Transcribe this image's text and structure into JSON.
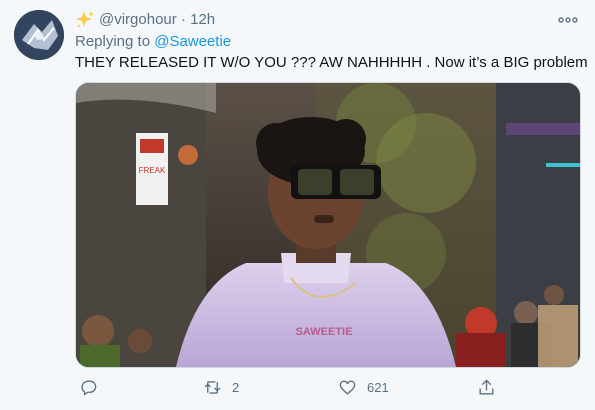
{
  "tweet": {
    "display_icon": "sparkles-icon",
    "handle": "@virgohour",
    "separator": "·",
    "time": "12h",
    "reply_prefix": "Replying to ",
    "reply_to": "@Saweetie",
    "text": "THEY RELEASED IT W/O YOU ??? AW NAHHHHH . Now it’s a BIG problem",
    "media": {
      "sign_text": "FREAK",
      "shirt_text": "SAWEETIE"
    },
    "actions": {
      "reply_count": "",
      "retweet_count": "2",
      "like_count": "621"
    }
  },
  "colors": {
    "background": "#f5f8fa",
    "text": "#0f1419",
    "secondary": "#5b7083",
    "link": "#1b95e0",
    "sparkle": "#ffcc4d"
  }
}
